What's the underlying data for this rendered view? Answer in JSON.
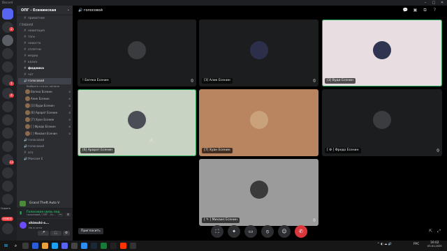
{
  "window": {
    "title": "Discord"
  },
  "colors": {
    "accent": "#5865f2",
    "green": "#23a55a",
    "red": "#da373c",
    "bg": "#000000"
  },
  "sidebar": {
    "guild": "ОПГ - Есенинская",
    "channels_top": [
      {
        "icon": "#",
        "label": "приватное"
      }
    ],
    "category": "ГЛАВНАЯ",
    "channels": [
      {
        "icon": "#",
        "label": "навигация"
      },
      {
        "icon": "#",
        "label": "тэги"
      },
      {
        "icon": "#",
        "label": "новости"
      },
      {
        "icon": "#",
        "label": "сплетни"
      },
      {
        "icon": "#",
        "label": "медиа"
      },
      {
        "icon": "#",
        "label": "казна"
      },
      {
        "icon": "#",
        "label": "фидмика"
      },
      {
        "icon": "#",
        "label": "чат"
      }
    ],
    "voice_channel": {
      "label": "голосовой",
      "subtitle": "Выбрать статус канала"
    },
    "voice_users": [
      {
        "label": "Евгека Есенин"
      },
      {
        "label": "Алик Есенин"
      },
      {
        "label": "[3] Вуди Есенин"
      },
      {
        "label": "[6] Арарат Есенин"
      },
      {
        "label": "[7] Хуан Есенин"
      },
      {
        "label": "[ ] Фредо Есенин"
      },
      {
        "label": "[ ] Михаил Есенин"
      }
    ],
    "voice_more": [
      {
        "icon": "🔊",
        "label": "голосовой"
      },
      {
        "icon": "🔊",
        "label": "голосовой"
      },
      {
        "icon": "#",
        "label": "ага"
      },
      {
        "icon": "🔊",
        "label": "Максим Е"
      }
    ],
    "game": "Grand Theft Auto V",
    "voice_status": "Голосовая связь под",
    "voice_sub": "голосовой / ОПГ - Ес...",
    "user_name": "shimshi-s...",
    "user_status": "Не в сети"
  },
  "servers": {
    "badges": [
      "2",
      "1",
      "4",
      "1",
      "12",
      "1",
      "2"
    ],
    "labels": [
      "Скрыть",
      "НОВОЕ"
    ]
  },
  "header": {
    "channel": "голосовой"
  },
  "tiles": [
    {
      "name": "! Евгека Есенин",
      "style": "dark"
    },
    {
      "name": "[3] Алик Есенин",
      "style": "dark"
    },
    {
      "name": "[3] Вуди Есенин",
      "style": "light",
      "speaking": true
    },
    {
      "name": "[6] Арарат Есенин",
      "style": "sage",
      "speaking": true
    },
    {
      "name": "[7] Хуан Есенин",
      "style": "tan"
    },
    {
      "name": "[ ⚙ ] Фредо Есенин",
      "style": "dark"
    },
    {
      "name": "[ ✎ ] Михаил Есенин",
      "style": "grey"
    }
  ],
  "bottom": {
    "invite": "Пригласить"
  },
  "taskbar": {
    "lang": "РУС",
    "time": "16:02",
    "date": "03.01.2025"
  }
}
